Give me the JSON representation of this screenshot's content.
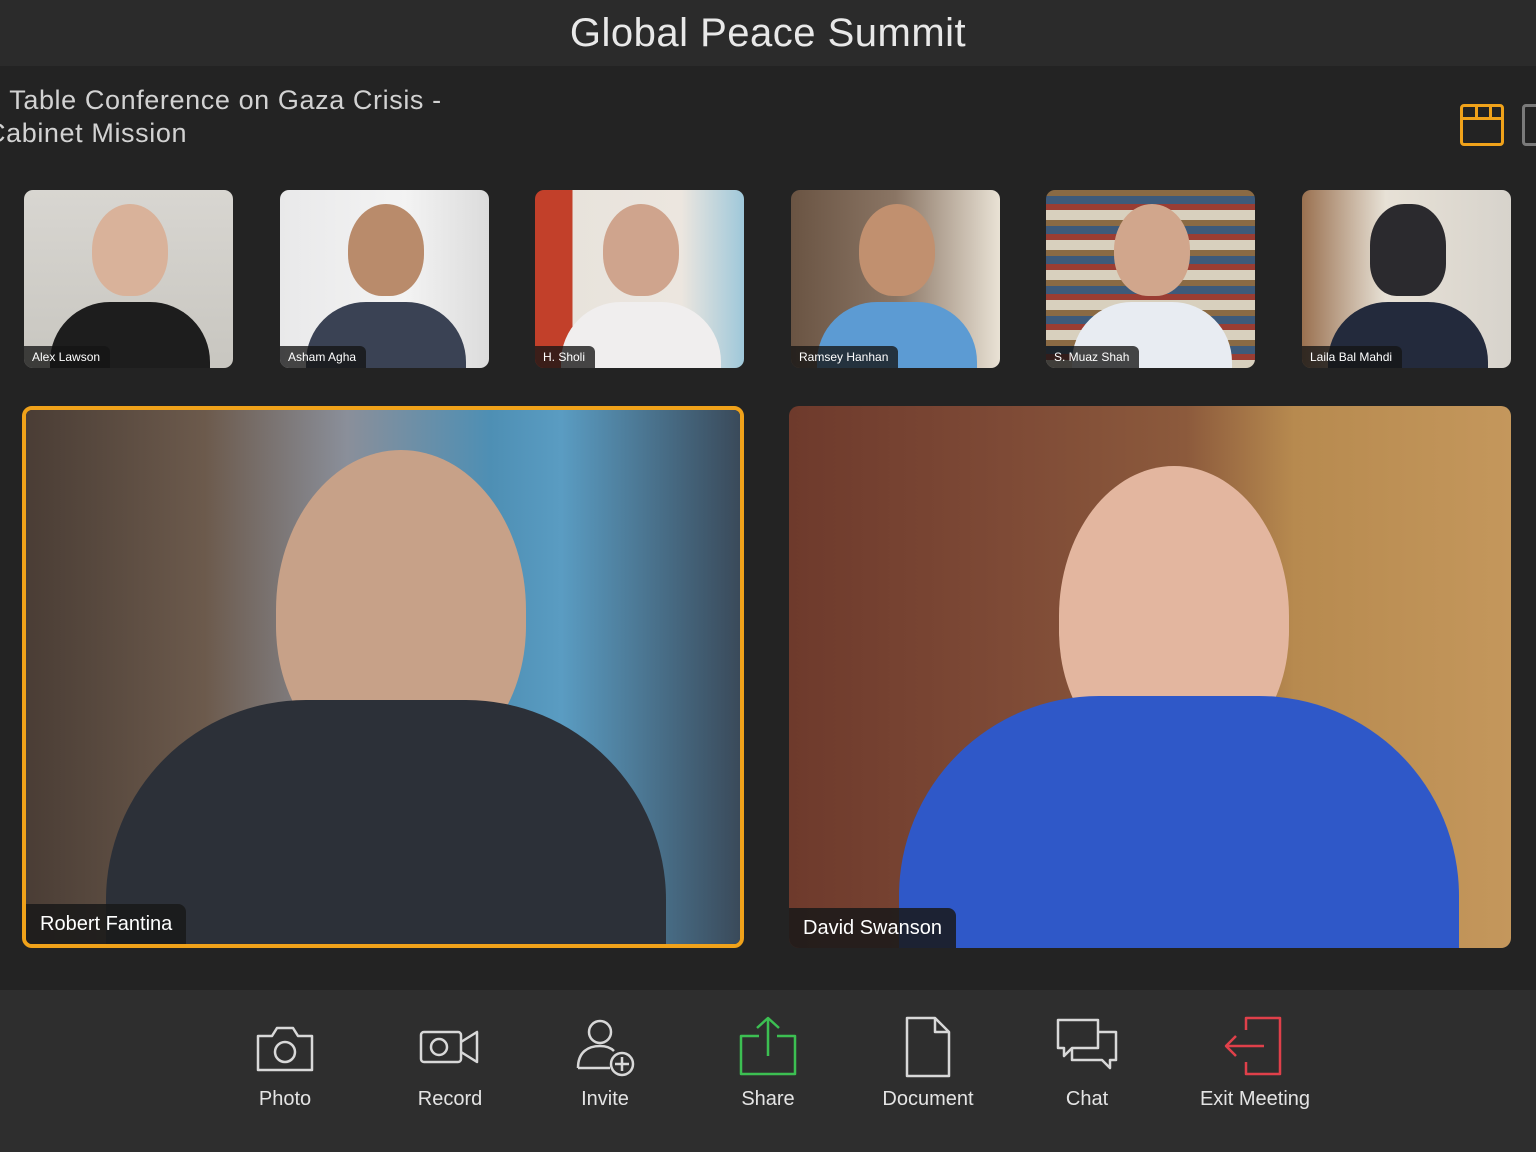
{
  "app": {
    "title": "Global Peace Summit"
  },
  "conference": {
    "title_line1": "d Table Conference on Gaza Crisis -",
    "title_line2": "Cabinet Mission"
  },
  "participants": [
    {
      "name": "Alex Lawson",
      "icon": "participant-video"
    },
    {
      "name": "Asham Agha",
      "icon": "participant-video"
    },
    {
      "name": "H. Sholi",
      "icon": "participant-video"
    },
    {
      "name": "Ramsey Hanhan",
      "icon": "participant-video"
    },
    {
      "name": "S. Muaz Shah",
      "icon": "participant-video"
    },
    {
      "name": "Laila Bal Mahdi",
      "icon": "participant-video"
    }
  ],
  "speakers": [
    {
      "name": "Robert Fantina",
      "active": true
    },
    {
      "name": "David Swanson",
      "active": false
    }
  ],
  "toolbar": {
    "photo": "Photo",
    "record": "Record",
    "invite": "Invite",
    "share": "Share",
    "document": "Document",
    "chat": "Chat",
    "exit": "Exit Meeting"
  },
  "colors": {
    "accent": "#f0a21a",
    "share": "#3cbf52",
    "exit": "#e0404a",
    "background": "#232323",
    "toolbar": "#2e2e2e"
  }
}
